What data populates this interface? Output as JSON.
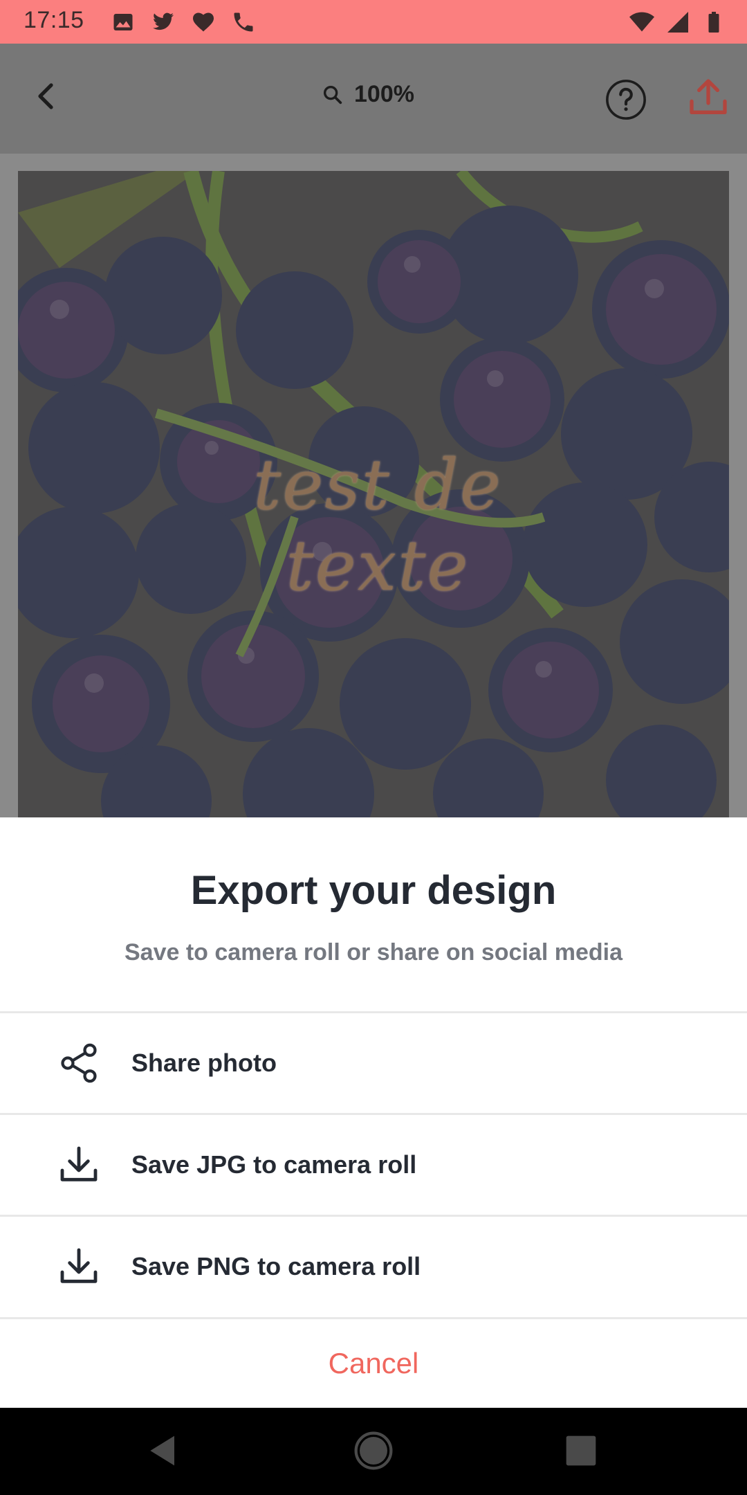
{
  "status_bar": {
    "time": "17:15",
    "left_icons": [
      "image-icon",
      "twitter-icon",
      "heart-icon",
      "phone-icon"
    ],
    "right_icons": [
      "wifi-icon",
      "signal-icon",
      "battery-icon"
    ],
    "background": "#fb7f7f"
  },
  "toolbar": {
    "zoom_label": "100%",
    "icons": [
      "back-icon",
      "zoom-icon",
      "help-icon",
      "export-icon"
    ]
  },
  "canvas": {
    "overlay_text": "test de texte"
  },
  "export_sheet": {
    "title": "Export your design",
    "subtitle": "Save to camera roll or share on social media",
    "options": [
      {
        "label": "Share photo",
        "icon": "share-icon"
      },
      {
        "label": "Save JPG to camera roll",
        "icon": "download-icon"
      },
      {
        "label": "Save PNG to camera roll",
        "icon": "download-icon"
      }
    ],
    "cancel_label": "Cancel"
  },
  "nav_bar": {
    "icons": [
      "nav-back-icon",
      "nav-home-icon",
      "nav-recents-icon"
    ]
  },
  "colors": {
    "accent": "#f0675e",
    "text_dark": "#252a33",
    "text_muted": "#747880"
  }
}
